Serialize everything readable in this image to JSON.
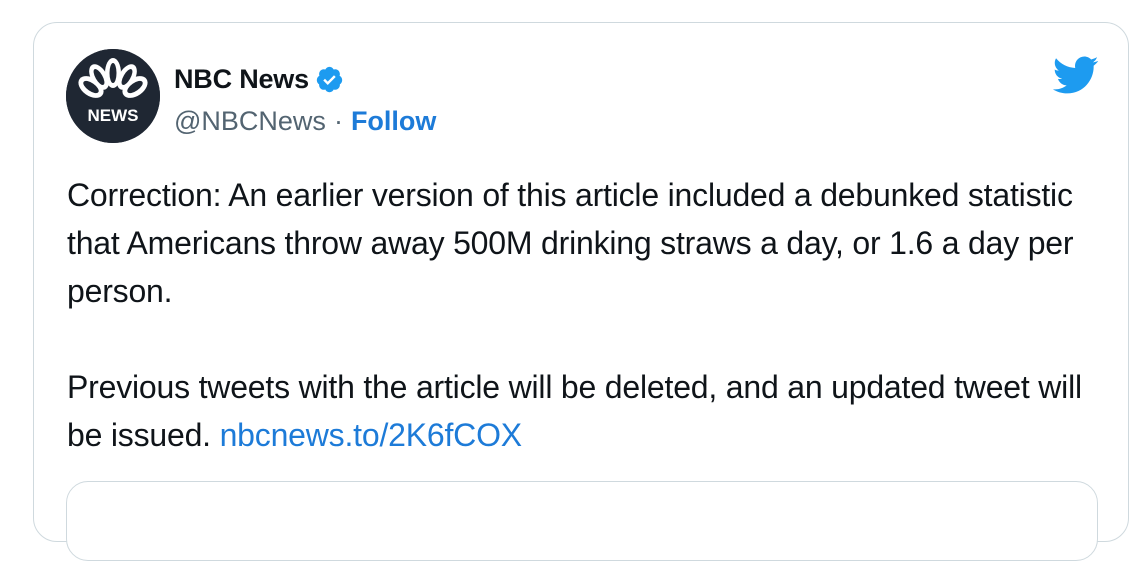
{
  "tweet": {
    "author": {
      "name": "NBC News",
      "handle": "@NBCNews",
      "separator": "·",
      "follow_label": "Follow",
      "avatar_text": "NEWS",
      "verified_icon": "verified-badge-icon"
    },
    "body": {
      "paragraph_1": "Correction: An earlier version of this article included a debunked statistic that Americans throw away 500M drinking straws a day, or 1.6 a day per person.",
      "paragraph_2_text": "Previous tweets with the article will be deleted, and an updated tweet will be issued. ",
      "link_text": "nbcnews.to/2K6fCOX"
    },
    "brand_icon": "twitter-bird-icon"
  },
  "colors": {
    "link": "#1d7bd8",
    "text": "#0f1419",
    "secondary_text": "#536471",
    "border": "#cfd9de",
    "twitter_blue": "#1d9bf0",
    "verified_blue": "#1d9bf0",
    "avatar_bg": "#1f2733"
  }
}
